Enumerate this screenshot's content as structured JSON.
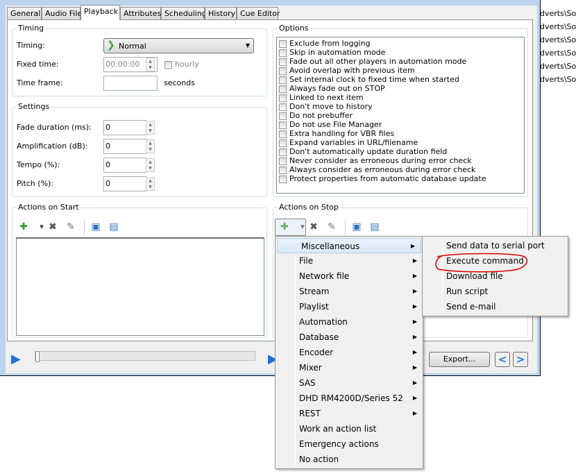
{
  "tabs": [
    "General",
    "Audio File",
    "Playback",
    "Attributes",
    "Scheduling",
    "History",
    "Cue Editor"
  ],
  "active_tab": "Playback",
  "background_list": [
    "dverts\\Soc",
    "dverts\\Soc",
    "dverts\\Soc",
    "dverts\\Soc",
    "dverts\\Soc",
    "dverts\\Soc"
  ],
  "timing": {
    "title": "Timing",
    "timing_label": "Timing:",
    "timing_value": "Normal",
    "fixed_time_label": "Fixed time:",
    "fixed_time_value": "00:00:00",
    "hourly_label": "hourly",
    "time_frame_label": "Time frame:",
    "time_frame_value": "",
    "seconds_label": "seconds"
  },
  "settings": {
    "title": "Settings",
    "fields": [
      {
        "label": "Fade duration (ms):",
        "value": "0"
      },
      {
        "label": "Amplification (dB):",
        "value": "0"
      },
      {
        "label": "Tempo (%):",
        "value": "0"
      },
      {
        "label": "Pitch (%):",
        "value": "0"
      }
    ]
  },
  "options": {
    "title": "Options",
    "items": [
      "Exclude from logging",
      "Skip in automation mode",
      "Fade out all other players in automation mode",
      "Avoid overlap with previous item",
      "Set internal clock to fixed time when started",
      "Always fade out on STOP",
      "Linked to next item",
      "Don't move to history",
      "Do not prebuffer",
      "Do not use File Manager",
      "Extra handling for VBR files",
      "Expand variables in URL/filename",
      "Don't automatically update duration field",
      "Never consider as erroneous during error check",
      "Always consider as erroneous during error check",
      "Protect properties from automatic database update"
    ]
  },
  "actions_start": {
    "title": "Actions on Start"
  },
  "actions_stop": {
    "title": "Actions on Stop"
  },
  "menu": {
    "items": [
      {
        "label": "Miscellaneous",
        "sub": true
      },
      {
        "label": "File",
        "sub": true
      },
      {
        "label": "Network file",
        "sub": true
      },
      {
        "label": "Stream",
        "sub": true
      },
      {
        "label": "Playlist",
        "sub": true
      },
      {
        "label": "Automation",
        "sub": true
      },
      {
        "label": "Database",
        "sub": true
      },
      {
        "label": "Encoder",
        "sub": true
      },
      {
        "label": "Mixer",
        "sub": true
      },
      {
        "label": "SAS",
        "sub": true
      },
      {
        "label": "DHD RM4200D/Series 52",
        "sub": true
      },
      {
        "label": "REST",
        "sub": true
      },
      {
        "label": "Work an action list",
        "sub": false
      },
      {
        "label": "Emergency actions",
        "sub": false
      },
      {
        "label": "No action",
        "sub": false
      }
    ],
    "highlighted": "Miscellaneous"
  },
  "submenu": {
    "items": [
      "Send data to serial port",
      "Execute command",
      "Download file",
      "Run script",
      "Send e-mail"
    ],
    "annotated": "Execute command",
    "annotation_color": "#e00000"
  },
  "bottom": {
    "export_label": "Export...",
    "player_progress": 0
  },
  "colors": {
    "accent": "#1e6fd9",
    "green": "#2a9a2a"
  }
}
